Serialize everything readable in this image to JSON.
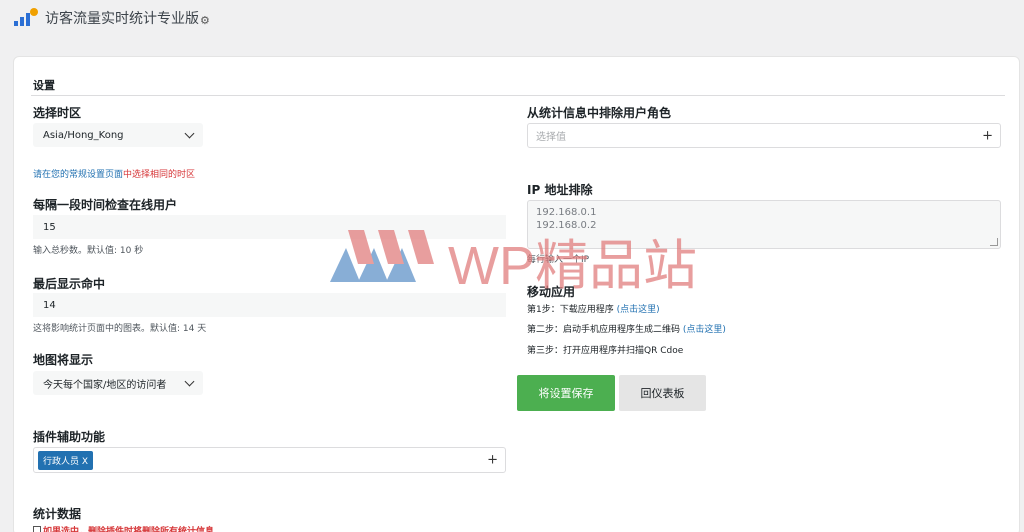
{
  "header": {
    "title": "访客流量实时统计专业版",
    "settings_icon": "gear-icon"
  },
  "settings": {
    "section_title": "设置",
    "timezone": {
      "label": "选择时区",
      "value": "Asia/Hong_Kong",
      "help_prefix": "请在您的常规设置页面",
      "help_highlight": "中选择相同的时区"
    },
    "online_check": {
      "label": "每隔一段时间检查在线用户",
      "value": "15",
      "help": "输入总秒数。默认值: 10 秒"
    },
    "last_hits": {
      "label": "最后显示命中",
      "value": "14",
      "help": "这将影响统计页面中的图表。默认值: 14 天"
    },
    "map": {
      "label": "地图将显示",
      "value": "今天每个国家/地区的访问者"
    },
    "plugin_access": {
      "label": "插件辅助功能",
      "tag": "行政人员 X"
    },
    "stats_data": {
      "label": "统计数据",
      "checkbox_text": "如果选中，删除插件时将删除所有统计信息"
    },
    "exclude_roles": {
      "label": "从统计信息中排除用户角色",
      "placeholder": "选择值"
    },
    "ip_exclude": {
      "label": "IP 地址排除",
      "value": "192.168.0.1\n192.168.0.2",
      "help": "每行输入一个IP"
    },
    "mobile": {
      "label": "移动应用",
      "step1": "第1步：下载应用程序",
      "step1_link": "(点击这里)",
      "step2": "第二步：启动手机应用程序生成二维码",
      "step2_link": "(点击这里)",
      "step3": "第三步：打开应用程序并扫描QR Cdoe"
    },
    "buttons": {
      "save": "将设置保存",
      "dashboard": "回仪表板"
    }
  },
  "watermark": {
    "text": "WP精品站"
  },
  "colors": {
    "accent": "#2271b1",
    "save": "#4caf50",
    "alert": "#d63638"
  }
}
